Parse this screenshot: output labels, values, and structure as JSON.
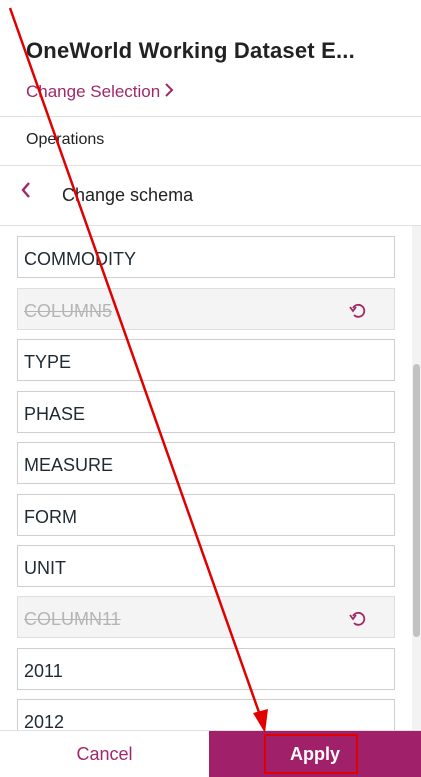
{
  "header": {
    "title": "OneWorld Working Dataset E...",
    "change_selection": "Change Selection"
  },
  "operations": {
    "label": "Operations"
  },
  "schema": {
    "title": "Change schema",
    "fields": [
      {
        "label": "COMMODITY",
        "removed": false
      },
      {
        "label": "COLUMN5",
        "removed": true
      },
      {
        "label": "TYPE",
        "removed": false
      },
      {
        "label": "PHASE",
        "removed": false
      },
      {
        "label": "MEASURE",
        "removed": false
      },
      {
        "label": "FORM",
        "removed": false
      },
      {
        "label": "UNIT",
        "removed": false
      },
      {
        "label": "COLUMN11",
        "removed": true
      },
      {
        "label": "2011",
        "removed": false
      },
      {
        "label": "2012",
        "removed": false
      }
    ]
  },
  "footer": {
    "cancel_label": "Cancel",
    "apply_label": "Apply"
  },
  "colors": {
    "accent": "#a0206a",
    "annotation": "#e00000"
  },
  "icons": {
    "back": "chevron-left-icon",
    "change_selection": "chevron-right-icon",
    "undo": "undo-icon"
  }
}
